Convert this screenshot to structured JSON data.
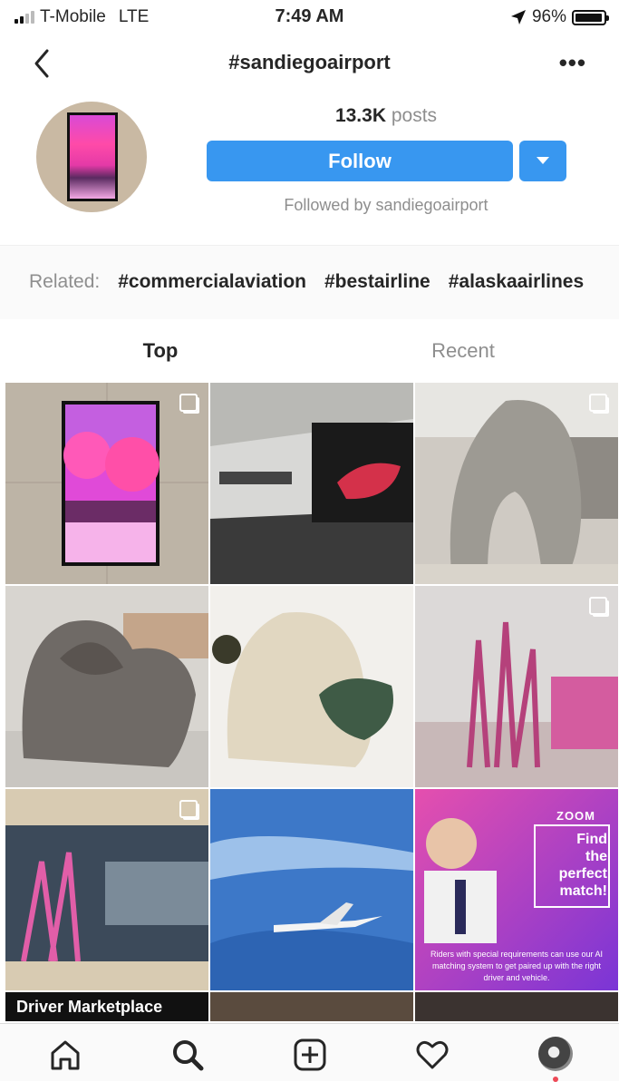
{
  "status_bar": {
    "carrier": "T-Mobile",
    "network": "LTE",
    "time": "7:49 AM",
    "battery": "96%",
    "battery_level": 0.96
  },
  "nav": {
    "title": "#sandiegoairport",
    "back_icon": "chevron-left-icon",
    "more_icon": "more-horizontal-icon"
  },
  "header": {
    "posts_count": "13.3K",
    "posts_label": "posts",
    "follow_label": "Follow",
    "followed_by": "Followed by sandiegoairport"
  },
  "related": {
    "label": "Related:",
    "tags": [
      "#commercialaviation",
      "#bestairline",
      "#alaskaairlines"
    ]
  },
  "tabs": {
    "top": "Top",
    "recent": "Recent"
  },
  "grid": {
    "tiles": [
      {
        "subject": "pink infrared forest video screen",
        "multi": true
      },
      {
        "subject": "airport gallery hallway",
        "multi": false
      },
      {
        "subject": "clay sculpture in workshop",
        "multi": true
      },
      {
        "subject": "clay sculpture with leaves",
        "multi": false
      },
      {
        "subject": "white clay sculpture with green",
        "multi": false
      },
      {
        "subject": "pink desert plant photo",
        "multi": true
      },
      {
        "subject": "mural of pink plants",
        "multi": true
      },
      {
        "subject": "airplane in blue sky",
        "multi": false
      },
      {
        "subject": "zoom ad",
        "multi": false
      }
    ],
    "ad": {
      "brand": "ZOOM",
      "headline_1": "Find",
      "headline_2": "the",
      "headline_3": "perfect",
      "headline_4": "match!",
      "body": "Riders with special requirements can use our AI matching system to get paired up with the right driver and vehicle."
    },
    "bottom_row_label": "Driver Marketplace"
  },
  "tab_bar": {
    "icons": [
      "home-icon",
      "search-icon",
      "new-post-icon",
      "activity-heart-icon",
      "profile-avatar"
    ]
  },
  "colors": {
    "accent_blue": "#3897f0",
    "text_dark": "#262626",
    "text_gray": "#8e8e8e"
  }
}
